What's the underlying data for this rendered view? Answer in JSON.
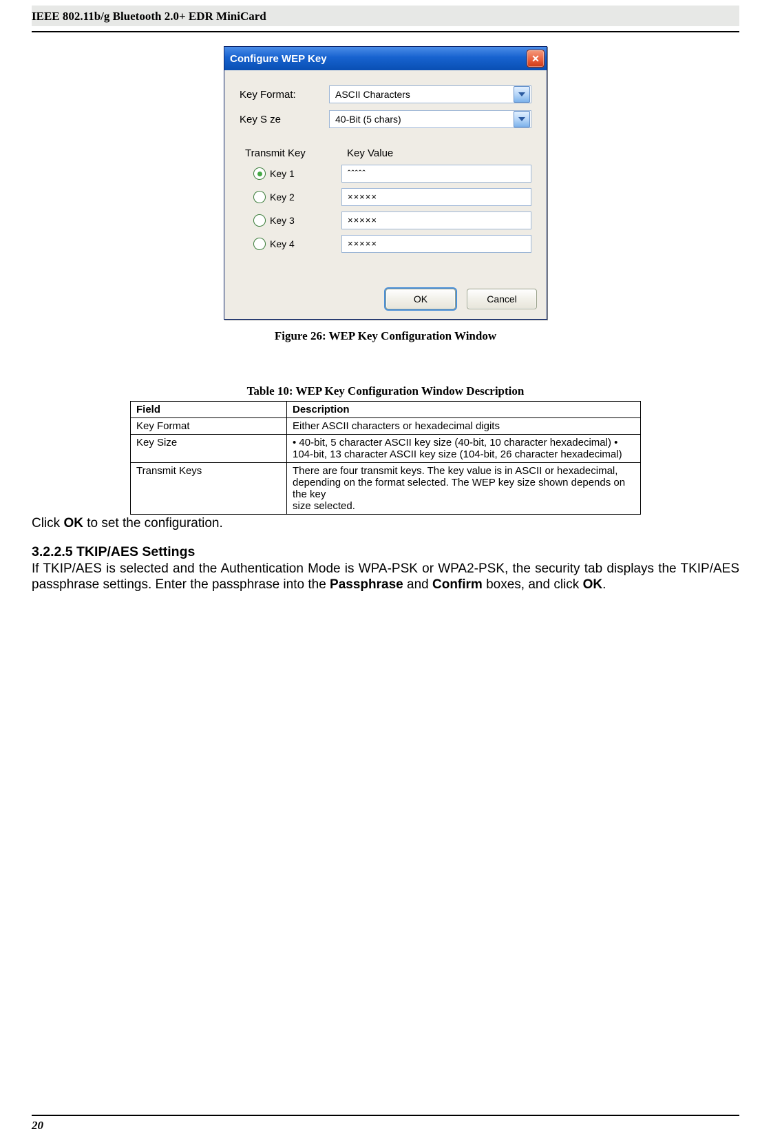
{
  "header": {
    "title": "IEEE 802.11b/g Bluetooth 2.0+ EDR MiniCard"
  },
  "footer": {
    "page_number": "20"
  },
  "dialog": {
    "title": "Configure WEP Key",
    "close_glyph": "✕",
    "key_format_label": "Key Format:",
    "key_size_label": "Key S ze",
    "key_format_value": "ASCII Characters",
    "key_size_value": "40-Bit (5 chars)",
    "transmit_key_label": "Transmit Key",
    "key_value_label": "Key Value",
    "keys": [
      {
        "label": "Key 1",
        "value": "ˆˆˆˆˆ",
        "selected": true
      },
      {
        "label": "Key 2",
        "value": "×××××",
        "selected": false
      },
      {
        "label": "Key 3",
        "value": "×××××",
        "selected": false
      },
      {
        "label": "Key 4",
        "value": "×××××",
        "selected": false
      }
    ],
    "ok_label": "OK",
    "cancel_label": "Cancel"
  },
  "figure_caption": "Figure 26: WEP Key Configuration Window",
  "table_caption": "Table 10: WEP Key Configuration Window Description",
  "table": {
    "head_field": "Field",
    "head_desc": "Description",
    "rows": [
      {
        "field": "Key Format",
        "desc": "Either ASCII characters or hexadecimal digits"
      },
      {
        "field": "Key Size",
        "desc": "• 40-bit, 5 character ASCII key size (40-bit, 10 character hexadecimal) • 104-bit, 13 character ASCII key size (104-bit, 26 character hexadecimal)"
      },
      {
        "field": "Transmit Keys",
        "desc": "There are four transmit keys. The key value is in ASCII or hexadecimal,\ndepending on the format selected. The WEP key size shown depends on the key\nsize selected."
      }
    ]
  },
  "post_table_text_prefix": "Click ",
  "post_table_text_bold": "OK",
  "post_table_text_suffix": " to set the configuration.",
  "section": {
    "heading": "3.2.2.5 TKIP/AES Settings",
    "p_prefix": "If TKIP/AES is selected and the Authentication Mode is WPA-PSK or WPA2-PSK, the security tab displays the TKIP/AES passphrase settings. Enter the passphrase into the ",
    "p_bold1": "Passphrase",
    "p_mid": " and ",
    "p_bold2": "Confirm",
    "p_after": " boxes, and click ",
    "p_bold3": "OK",
    "p_end": "."
  }
}
